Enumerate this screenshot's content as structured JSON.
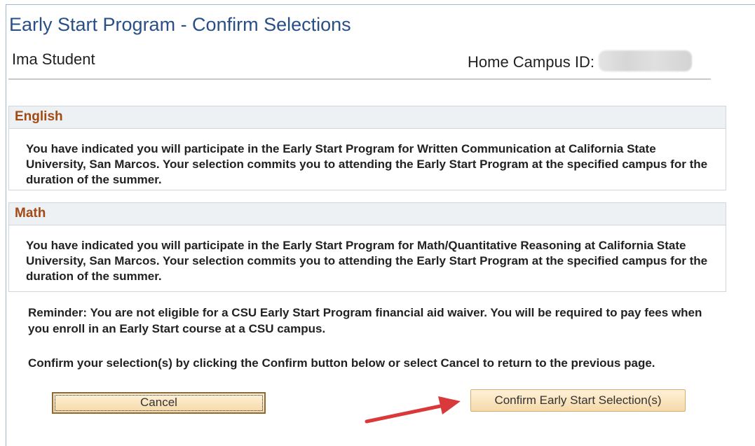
{
  "header": {
    "title": "Early Start Program - Confirm Selections",
    "student_name": "Ima Student",
    "campus_id_label": "Home Campus ID:"
  },
  "sections": [
    {
      "heading": "English",
      "text": "You have indicated you will participate in the Early Start Program for Written Communication at California State University, San Marcos.  Your selection commits you to attending the Early Start Program at the specified campus for the duration of the summer."
    },
    {
      "heading": "Math",
      "text": "You have indicated you will participate in the Early Start Program for Math/Quantitative Reasoning at California State University, San Marcos.  Your selection commits you to attending the Early Start Program at the specified campus for the duration of the summer."
    }
  ],
  "reminder": "Reminder: You are not  eligible for a CSU Early Start Program financial aid waiver. You will be required to pay fees when you enroll in an Early Start course at a CSU campus.",
  "instructions": "Confirm your selection(s) by clicking the Confirm button below or select Cancel to return to the previous page.",
  "buttons": {
    "cancel": "Cancel",
    "confirm": "Confirm Early Start Selection(s)"
  },
  "colors": {
    "title": "#284f86",
    "section_heading": "#a24a14",
    "button_fill": "#f5d9a8",
    "arrow": "#d9393a"
  }
}
